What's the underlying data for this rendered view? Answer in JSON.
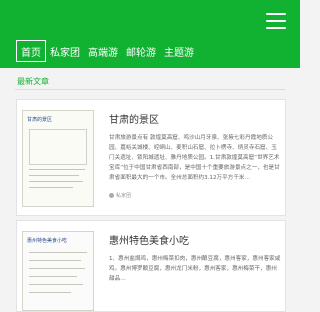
{
  "header": {
    "nav": [
      {
        "label": "首页",
        "active": true
      },
      {
        "label": "私家团",
        "active": false
      },
      {
        "label": "高端游",
        "active": false
      },
      {
        "label": "邮轮游",
        "active": false
      },
      {
        "label": "主题游",
        "active": false
      }
    ],
    "menu_icon": "hamburger-menu-icon"
  },
  "section": {
    "title": "最新文章"
  },
  "articles": [
    {
      "title": "甘肃的景区",
      "thumb_title": "甘肃的景区",
      "excerpt": "甘肃旅游景点有 敦煌莫高窟、鸣沙山月牙泉、张掖七彩丹霞地质公园、嘉峪关城楼、崆峒山、麦积山石窟、拉卜楞寺、炳灵寺石窟、玉门关遗址、锁阳城遗址、雅丹地质公园。1.甘肃敦煌莫高窟“世界艺术宝库”位于中国甘肃省西南部，是中国十个重要旅游景点之一，也是甘肃省面积最大的一个市。全州总面积约3.12万平方千米…",
      "meta": "私家团"
    },
    {
      "title": "惠州特色美食小吃",
      "thumb_title": "惠州特色美食小吃",
      "excerpt": "1、惠州盐焗鸡，惠州梅菜扣肉，惠州酿豆腐，惠州客家，惠州客家咸鸡，惠州博罗酿豆腐，惠州龙门米粉，惠州客家，惠州梅菜干，惠州甜品…",
      "meta": ""
    }
  ],
  "colors": {
    "brand": "#11b232"
  }
}
